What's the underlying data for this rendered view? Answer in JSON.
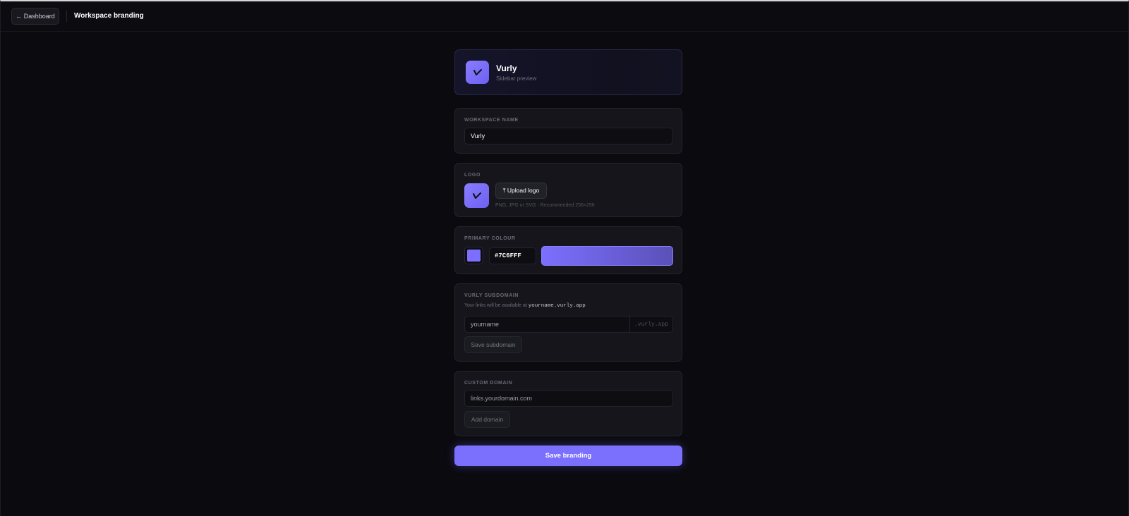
{
  "header": {
    "back_label": "← Dashboard",
    "page_title": "Workspace branding"
  },
  "preview": {
    "name": "Vurly",
    "subtitle": "Sidebar preview",
    "logo_icon": "vurly-logo-icon"
  },
  "workspace_name": {
    "label": "WORKSPACE NAME",
    "value": "Vurly"
  },
  "logo": {
    "label": "LOGO",
    "upload_label": "⤒ Upload logo",
    "hint": "PNG, JPG or SVG · Recommended 256×256"
  },
  "primary_colour": {
    "label": "PRIMARY COLOUR",
    "hex_value": "#7C6FFF",
    "swatch_color": "#7c6fff",
    "gradient_end": "#5a51b8"
  },
  "subdomain": {
    "label": "VURLY SUBDOMAIN",
    "help_prefix": "Your links will be available at ",
    "help_code": "yourname.vurly.app",
    "placeholder": "yourname",
    "suffix": ".vurly.app",
    "save_label": "Save subdomain"
  },
  "custom_domain": {
    "label": "CUSTOM DOMAIN",
    "placeholder": "links.yourdomain.com",
    "add_label": "Add domain"
  },
  "save_branding_label": "Save branding",
  "colors": {
    "accent": "#7c6fff",
    "background": "#0a0a0f",
    "card": "#15151b"
  }
}
